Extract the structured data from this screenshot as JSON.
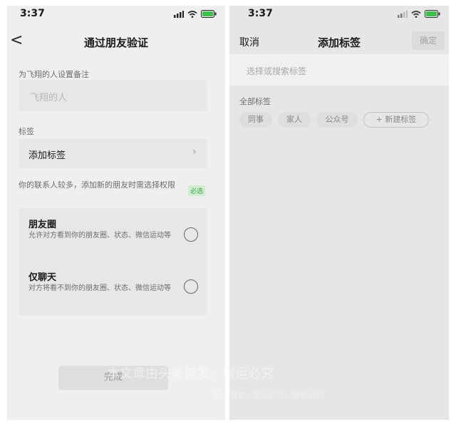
{
  "left": {
    "status": {
      "time": "3:37"
    },
    "nav": {
      "title": "通过朋友验证",
      "back_glyph": "<"
    },
    "remark": {
      "label": "为飞翔的人设置备注",
      "placeholder": "飞翔的人"
    },
    "tags": {
      "label": "标签",
      "add_label": "添加标签",
      "chevron": "›"
    },
    "permission": {
      "notice": "你的联系人较多，添加新的朋友时需选择权限",
      "required_badge": "必选",
      "options": [
        {
          "title": "朋友圈",
          "desc": "允许对方看到你的朋友圈、状态、微信运动等"
        },
        {
          "title": "仅聊天",
          "desc": "对方将看不到你的朋友圈、状态、微信运动等"
        }
      ]
    },
    "done_button": "完成"
  },
  "right": {
    "status": {
      "time": "3:37"
    },
    "nav": {
      "cancel": "取消",
      "title": "添加标签",
      "confirm": "确定"
    },
    "search": {
      "placeholder": "选择或搜索标签"
    },
    "all_tags": {
      "label": "全部标签",
      "items": [
        "同事",
        "家人",
        "公众号"
      ],
      "new_tag": "+ 新建标签"
    }
  },
  "watermark": {
    "line1": "本文章由头条首发，搬运必究",
    "line2": "头条首发，搬运必究，侵权必究"
  },
  "colors": {
    "accent_green": "#3aa545",
    "badge_bg": "#d3ecd3"
  }
}
